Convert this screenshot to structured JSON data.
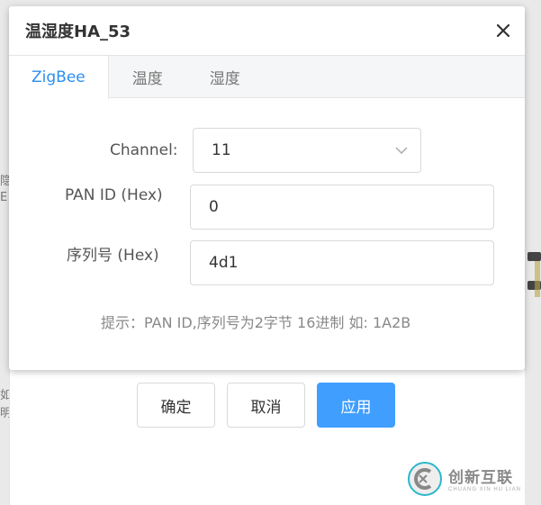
{
  "dialog": {
    "title": "温湿度HA_53",
    "close_symbol": "✕"
  },
  "tabs": [
    {
      "label": "ZigBee",
      "active": true
    },
    {
      "label": "温度",
      "active": false
    },
    {
      "label": "湿度",
      "active": false
    }
  ],
  "form": {
    "channel_label": "Channel:",
    "channel_value": "11",
    "pan_id_label": "PAN ID (Hex)",
    "pan_id_value": "0",
    "serial_label": "序列号 (Hex)",
    "serial_value": "4d1",
    "hint": "提示：PAN ID,序列号为2字节 16进制 如: 1A2B"
  },
  "buttons": {
    "ok": "确定",
    "cancel": "取消",
    "apply": "应用"
  },
  "watermark": {
    "main": "创新互联",
    "sub": "CHUANG XIN HU LIAN"
  },
  "colors": {
    "accent": "#409eff",
    "tab_active": "#2c8ff0"
  }
}
